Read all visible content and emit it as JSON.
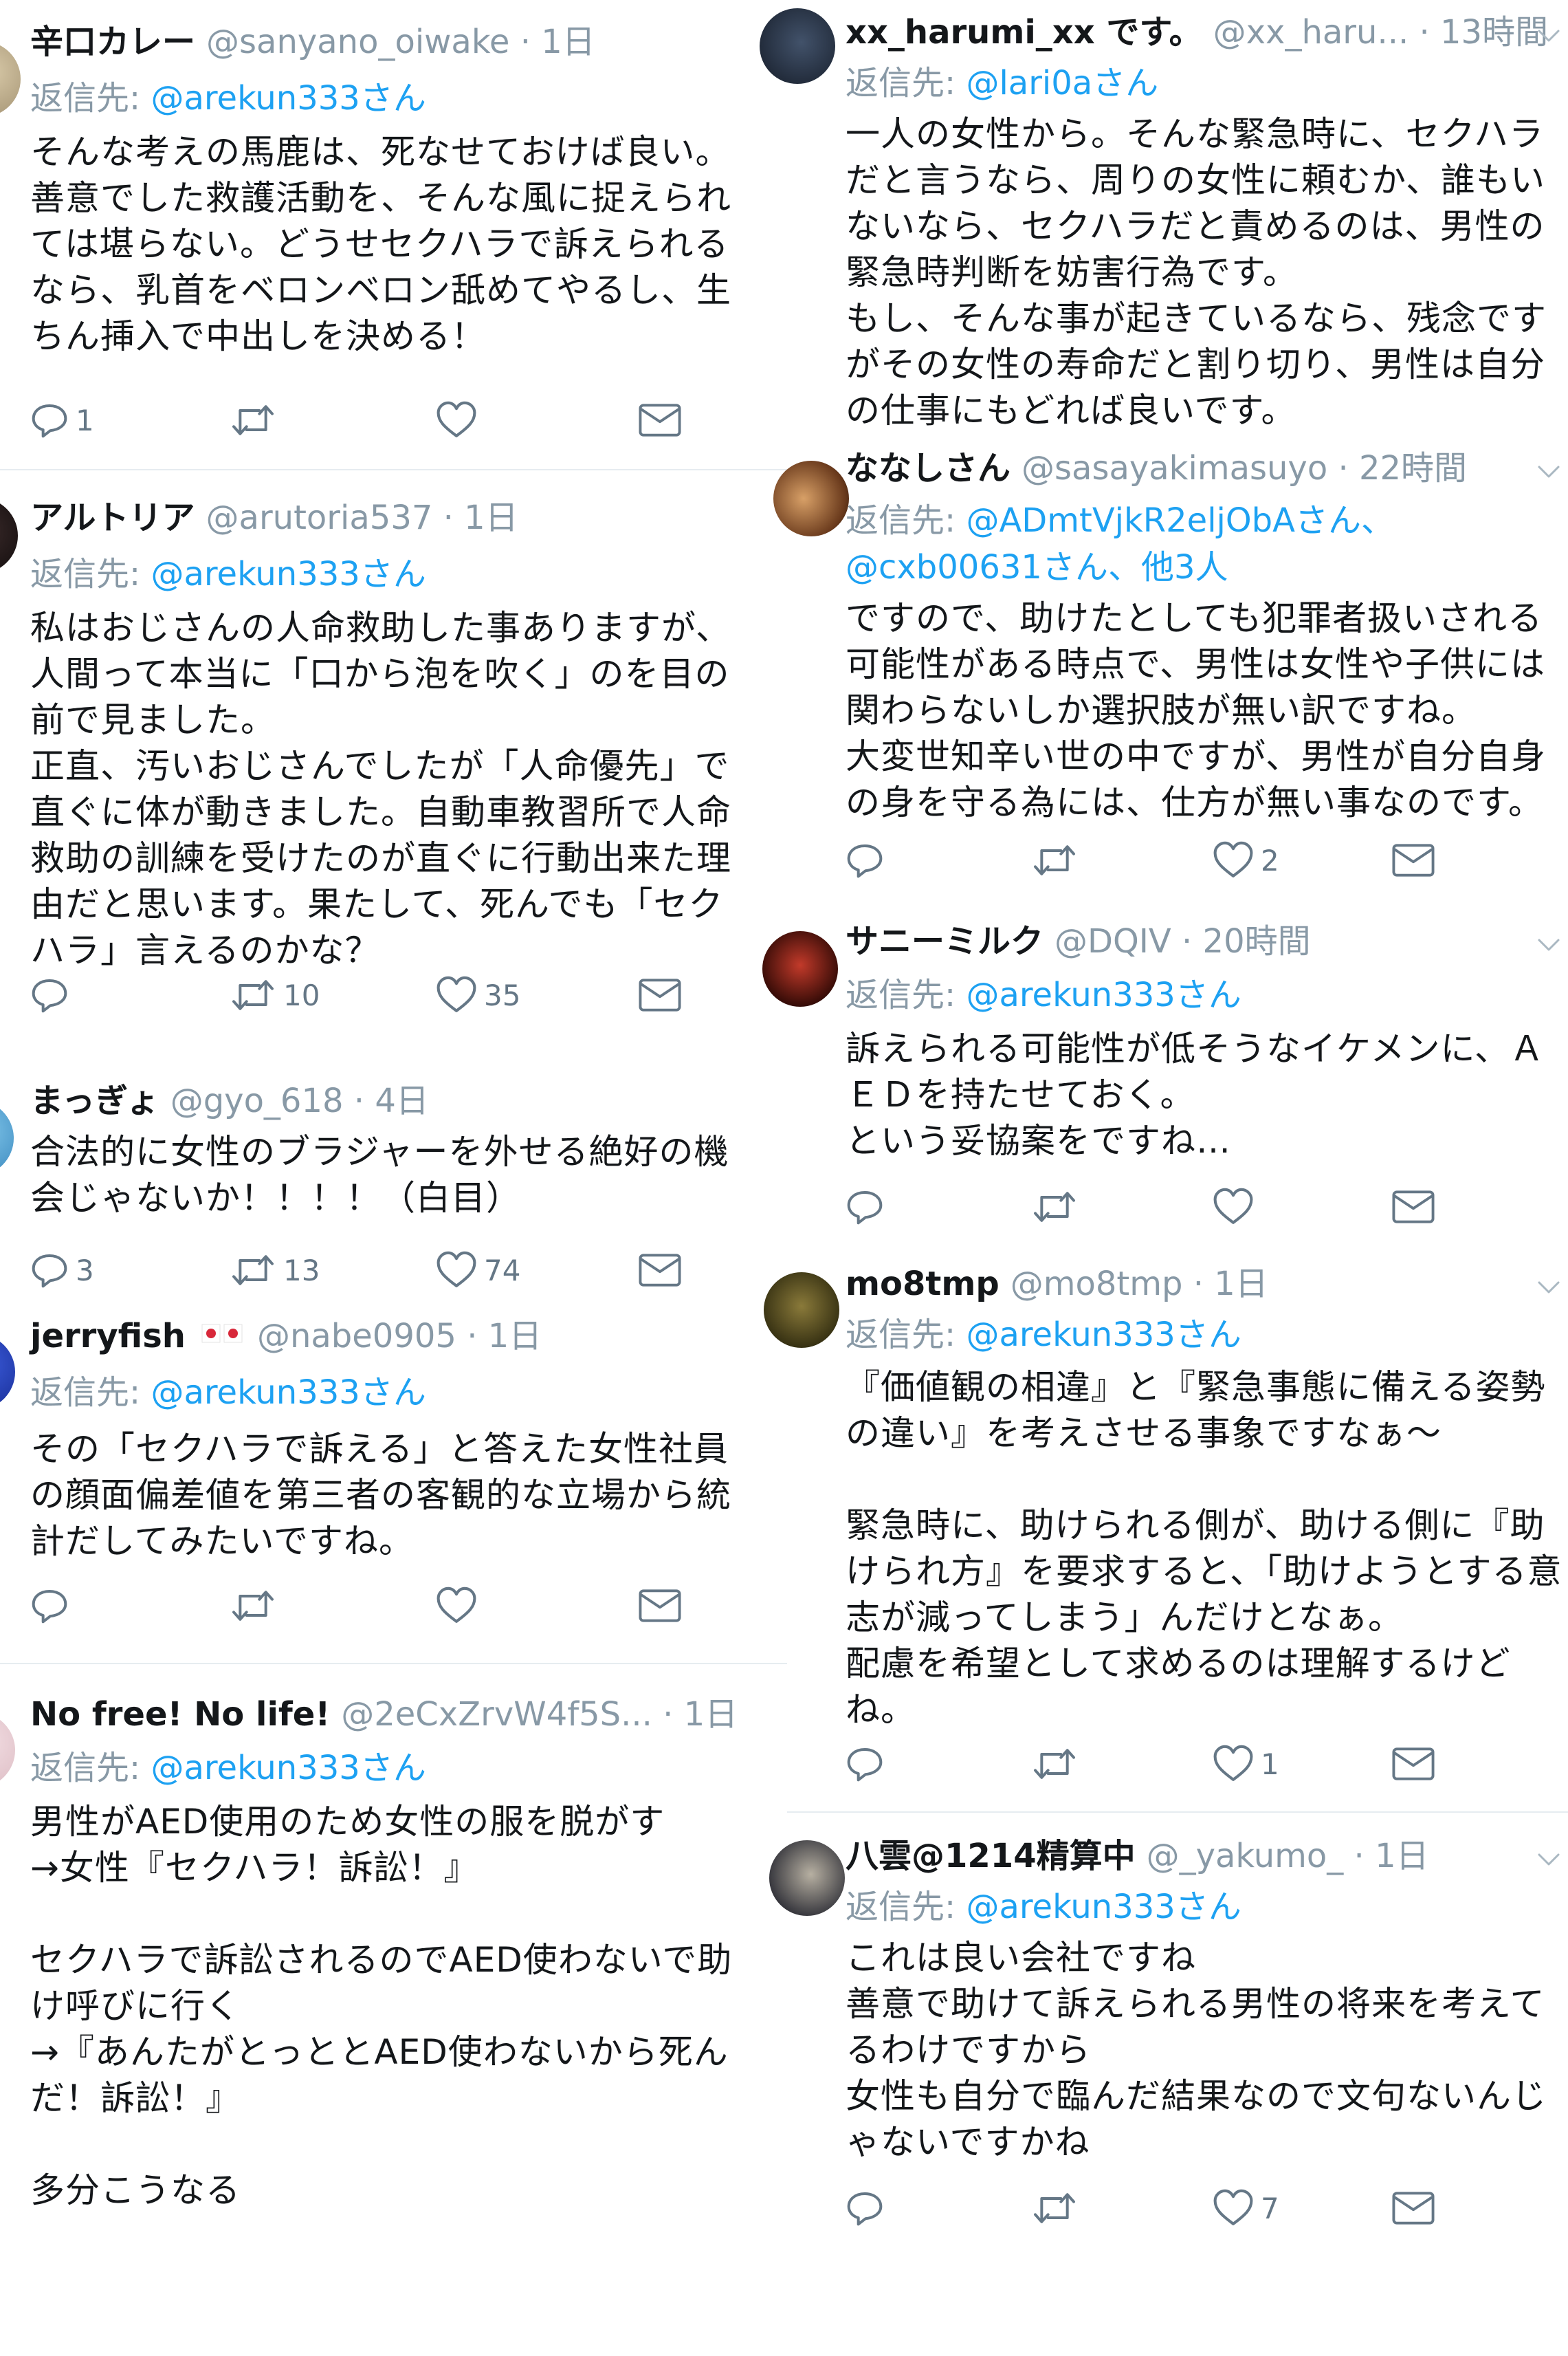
{
  "labels": {
    "reply_to": "返信先: "
  },
  "left_tweets": [
    {
      "name": "辛口カレー",
      "handle": "@sanyano_oiwake",
      "time": "1日",
      "reply_to": "@arekun333さん",
      "text": "そんな考えの馬鹿は、死なせておけば良い。\n善意でした救護活動を、そんな風に捉えられ\nては堪らない。どうせセクハラで訴えられる\nなら、乳首をベロンベロン舐めてやるし、生\nちん挿入で中出しを決める！",
      "replies": "1",
      "retweets": "",
      "likes": ""
    },
    {
      "name": "アルトリア",
      "handle": "@arutoria537",
      "time": "1日",
      "reply_to": "@arekun333さん",
      "text": "私はおじさんの人命救助した事ありますが、\n人間って本当に「口から泡を吹く」のを目の\n前で見ました。\n正直、汚いおじさんでしたが「人命優先」で\n直ぐに体が動きました。自動車教習所で人命\n救助の訓練を受けたのが直ぐに行動出来た理\n由だと思います。果たして、死んでも「セク\nハラ」言えるのかな？",
      "replies": "",
      "retweets": "10",
      "likes": "35"
    },
    {
      "name": "まっぎょ",
      "handle": "@gyo_618",
      "time": "4日",
      "text": "合法的に女性のブラジャーを外せる絶好の機\n会じゃないか！！！！（白目）",
      "replies": "3",
      "retweets": "13",
      "likes": "74"
    },
    {
      "name": "jerryfish",
      "handle": "@nabe0905",
      "time": "1日",
      "reply_to": "@arekun333さん",
      "text": "その「セクハラで訴える」と答えた女性社員\nの顔面偏差値を第三者の客観的な立場から統\n計だしてみたいですね。",
      "replies": "",
      "retweets": "",
      "likes": ""
    },
    {
      "name": "No free! No life!",
      "handle": "@2eCxZrvW4f5S...",
      "time": "1日",
      "reply_to": "@arekun333さん",
      "text": "男性がAED使用のため女性の服を脱がす\n→女性『セクハラ！訴訟！』\n\nセクハラで訴訟されるのでAED使わないで助\nけ呼びに行く\n→『あんたがとっととAED使わないから死ん\nだ！訴訟！』\n\n多分こうなる"
    }
  ],
  "right_tweets": [
    {
      "name": "xx_harumi_xx です。",
      "handle": "@xx_haru...",
      "time": "13時間",
      "reply_to": "@lari0aさん",
      "text": "一人の女性から。そんな緊急時に、セクハラ\nだと言うなら、周りの女性に頼むか、誰もい\nないなら、セクハラだと責めるのは、男性の\n緊急時判断を妨害行為です。\nもし、そんな事が起きているなら、残念です\nがその女性の寿命だと割り切り、男性は自分\nの仕事にもどれば良いです。"
    },
    {
      "name": "ななしさん",
      "handle": "@sasayakimasuyo",
      "time": "22時間",
      "reply_to": "@ADmtVjkR2eljObAさん、",
      "reply_to_2": "@cxb00631さん、他3人",
      "text": "ですので、助けたとしても犯罪者扱いされる\n可能性がある時点で、男性は女性や子供には\n関わらないしか選択肢が無い訳ですね。\n大変世知辛い世の中ですが、男性が自分自身\nの身を守る為には、仕方が無い事なのです。",
      "replies": "",
      "retweets": "",
      "likes": "2"
    },
    {
      "name": "サニーミルク",
      "handle": "@DQIV",
      "time": "20時間",
      "reply_to": "@arekun333さん",
      "text": "訴えられる可能性が低そうなイケメンに、Ａ\nＥＤを持たせておく。\nという妥協案をですね…",
      "replies": "",
      "retweets": "",
      "likes": ""
    },
    {
      "name": "mo8tmp",
      "handle": "@mo8tmp",
      "time": "1日",
      "reply_to": "@arekun333さん",
      "text": "『価値観の相違』と『緊急事態に備える姿勢\nの違い』を考えさせる事象ですなぁ〜\n\n緊急時に、助けられる側が、助ける側に『助\nけられ方』を要求すると、「助けようとする意\n志が減ってしまう」んだけとなぁ。\n配慮を希望として求めるのは理解するけど\nね。",
      "replies": "",
      "retweets": "",
      "likes": "1"
    },
    {
      "name": "八雲@1214精算中",
      "handle": "@_yakumo_",
      "time": "1日",
      "reply_to": "@arekun333さん",
      "text": "これは良い会社ですね\n善意で助けて訴えられる男性の将来を考えて\nるわけですから\n女性も自分で臨んだ結果なので文句ないんじ\nゃないですかね",
      "replies": "",
      "retweets": "",
      "likes": "7"
    }
  ],
  "colors": {
    "text": "#14171a",
    "meta": "#8899a6",
    "mention": "#1da1f2",
    "icon": "#657786",
    "divider": "#e6ecf0"
  },
  "icons": [
    "reply-icon",
    "retweet-icon",
    "like-icon",
    "direct-message-icon",
    "chevron-down-icon",
    "flag-emoji-icon"
  ]
}
